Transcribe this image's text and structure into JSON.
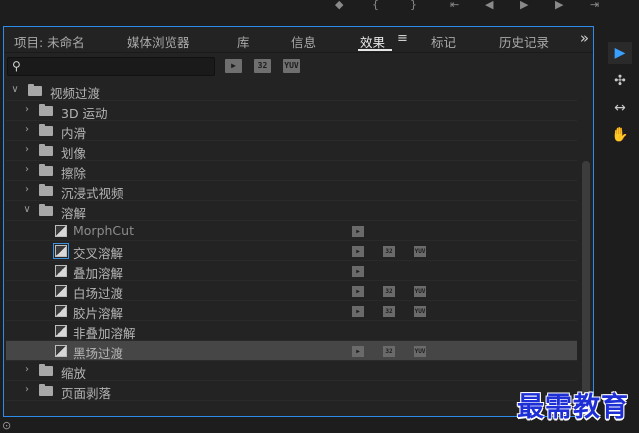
{
  "tabs": [
    {
      "label": "项目: 未命名"
    },
    {
      "label": "媒体浏览器"
    },
    {
      "label": "库"
    },
    {
      "label": "信息"
    },
    {
      "label": "效果"
    },
    {
      "label": "标记"
    },
    {
      "label": "历史记录"
    }
  ],
  "active_tab": "效果",
  "tab_menu_glyph": "≡",
  "tab_overflow_glyph": "»",
  "search": {
    "value": "",
    "placeholder": ""
  },
  "filter_buttons": [
    "▶",
    "32",
    "YUV"
  ],
  "tree": {
    "root": "视频过渡",
    "folders": [
      {
        "label": "3D 运动"
      },
      {
        "label": "内滑"
      },
      {
        "label": "划像"
      },
      {
        "label": "擦除"
      },
      {
        "label": "沉浸式视频"
      },
      {
        "label": "溶解"
      }
    ],
    "dissolve_items": [
      {
        "label": "MorphCut",
        "badges": [
          "▶"
        ]
      },
      {
        "label": "交叉溶解",
        "badges": [
          "▶",
          "32",
          "YUV"
        ]
      },
      {
        "label": "叠加溶解",
        "badges": [
          "▶"
        ]
      },
      {
        "label": "白场过渡",
        "badges": [
          "▶",
          "32",
          "YUV"
        ]
      },
      {
        "label": "胶片溶解",
        "badges": [
          "▶",
          "32",
          "YUV"
        ]
      },
      {
        "label": "非叠加溶解",
        "badges": []
      },
      {
        "label": "黑场过渡",
        "badges": [
          "▶",
          "32",
          "YUV"
        ]
      }
    ],
    "after_folders": [
      {
        "label": "缩放"
      },
      {
        "label": "页面剥落"
      }
    ]
  },
  "tools": [
    {
      "name": "selection-tool",
      "glyph": "▶"
    },
    {
      "name": "track-select-tool",
      "glyph": "✣"
    },
    {
      "name": "ripple-edit-tool",
      "glyph": "↔"
    },
    {
      "name": "hand-tool",
      "glyph": "✋"
    }
  ],
  "watermark": "最需教育",
  "colors": {
    "accent": "#2d8ceb",
    "panel": "#232323",
    "selected_row": "#464646"
  }
}
